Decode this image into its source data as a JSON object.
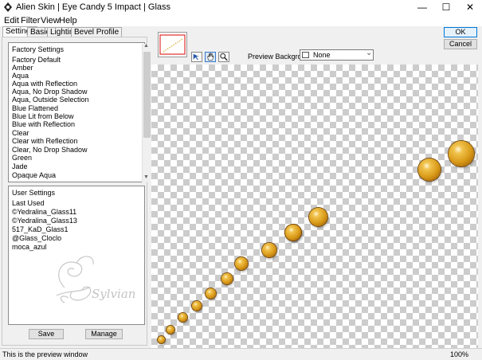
{
  "window": {
    "title": "Alien Skin | Eye Candy 5 Impact | Glass",
    "minimize_glyph": "—",
    "maximize_glyph": "☐",
    "close_glyph": "✕"
  },
  "menu": [
    "Edit",
    "Filter",
    "View",
    "Help"
  ],
  "tabs": [
    "Settings",
    "Basic",
    "Lighting",
    "Bevel Profile"
  ],
  "factory": {
    "header": "Factory Settings",
    "items": [
      "Factory Default",
      "Amber",
      "Aqua",
      "Aqua with Reflection",
      "Aqua, No Drop Shadow",
      "Aqua, Outside Selection",
      "Blue Flattened",
      "Blue Lit from Below",
      "Blue with Reflection",
      "Clear",
      "Clear with Reflection",
      "Clear, No Drop Shadow",
      "Green",
      "Jade",
      "Opaque Aqua"
    ],
    "scroll_up": "▲",
    "scroll_down": "▼"
  },
  "user": {
    "header": "User Settings",
    "items": [
      "Last Used",
      "©Yedralina_Glass11",
      "©Yedralina_Glass13",
      "517_KaD_Glass1",
      "@Glass_Cloclo",
      "moca_azul"
    ],
    "watermark_text": "Sylviane"
  },
  "buttons": {
    "save": "Save",
    "manage": "Manage",
    "ok": "OK",
    "cancel": "Cancel"
  },
  "preview_bg": {
    "label": "Preview Background:",
    "value": "None",
    "arrow": "⌄"
  },
  "tools": [
    "select-tool-icon",
    "hand-tool-icon",
    "zoom-tool-icon"
  ],
  "colors": {
    "bead": "#d99a18",
    "nav_rect": "#e03030",
    "checker": "#cccccc",
    "ok_border": "#0078d7"
  },
  "status": {
    "message": "This is the preview window",
    "zoom": "100%"
  }
}
